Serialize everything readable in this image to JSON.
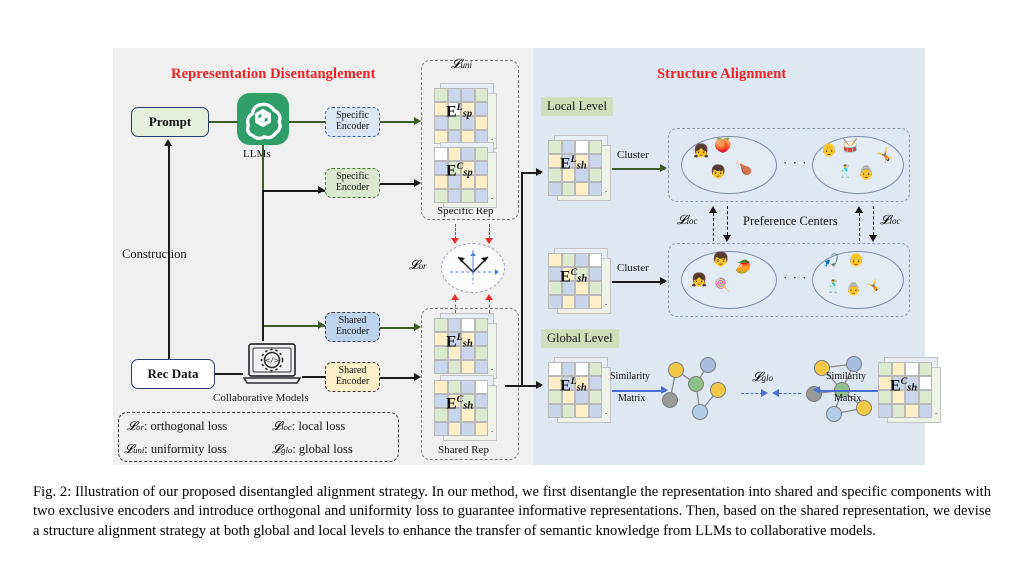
{
  "figure": {
    "panels": {
      "left": {
        "title": "Representation Disentanglement",
        "bg": "#f0f0f0"
      },
      "right": {
        "title": "Structure Alignment",
        "bg": "#dde8f3"
      }
    },
    "title_color": "#ee2020",
    "left_flow": {
      "prompt_label": "Prompt",
      "rec_data_label": "Rec Data",
      "construction_label": "Construction",
      "llms_label": "LLMs",
      "collaborative_models_label": "Collaborative Models",
      "encoders": [
        {
          "id": "specific-l",
          "line1": "Specific",
          "line2": "Encoder",
          "fill": "#dce7f5",
          "border": "#3b62a8"
        },
        {
          "id": "specific-c",
          "line1": "Specific",
          "line2": "Encoder",
          "fill": "#d9e8cf",
          "border": "#4d7a36"
        },
        {
          "id": "shared-l",
          "line1": "Shared",
          "line2": "Encoder",
          "fill": "#bdd3ee",
          "border": "#3a3a3a"
        },
        {
          "id": "shared-c",
          "line1": "Shared",
          "line2": "Encoder",
          "fill": "#fdf0c9",
          "border": "#3a3a3a"
        }
      ],
      "specific_rep_label": "Specific Rep",
      "shared_rep_label": "Shared Rep",
      "uniformity_loss": "𝓛",
      "uniformity_loss_sub": "uni",
      "orthogonal_loss": "𝓛",
      "orthogonal_loss_sub": "or"
    },
    "matrices": {
      "sp_l": {
        "base": "E",
        "sup": "L",
        "sub": "sp"
      },
      "sp_c": {
        "base": "E",
        "sup": "C",
        "sub": "sp"
      },
      "sh_l_left": {
        "base": "E",
        "sup": "L",
        "sub": "sh"
      },
      "sh_c_left": {
        "base": "E",
        "sup": "C",
        "sub": "sh"
      },
      "sh_l_local": {
        "base": "E",
        "sup": "L",
        "sub": "sh"
      },
      "sh_c_local": {
        "base": "E",
        "sup": "C",
        "sub": "sh"
      },
      "sh_l_global": {
        "base": "E",
        "sup": "L",
        "sub": "sh"
      },
      "sh_c_global": {
        "base": "E",
        "sup": "C",
        "sub": "sh"
      },
      "cell_palette": [
        "#fdf0c9",
        "#c9d6ec",
        "#dcead0",
        "#ffffff"
      ]
    },
    "right_flow": {
      "local_level_label": "Local Level",
      "global_level_label": "Global Level",
      "cluster_label_top": "Cluster",
      "cluster_label_bottom": "Cluster",
      "preference_centers_label": "Preference Centers",
      "local_loss_left": "𝓛",
      "local_loss_left_sub": "loc",
      "local_loss_right": "𝓛",
      "local_loss_right_sub": "loc",
      "global_loss": "𝓛",
      "global_loss_sub": "glo",
      "similarity_matrix_left_l1": "Similarity",
      "similarity_matrix_left_l2": "Matrix",
      "similarity_matrix_right_l1": "Similarity",
      "similarity_matrix_right_l2": "Matrix",
      "ellipsis": "· · ·",
      "clusters": {
        "top_left": [
          "👧",
          "🍑",
          "👦",
          "🍗"
        ],
        "top_right": [
          "👴",
          "🥁",
          "🕺",
          "👵",
          "🤸"
        ],
        "bottom_left": [
          "👦",
          "🥭",
          "👧",
          "🍭"
        ],
        "bottom_right": [
          "🎣",
          "👴",
          "🕺",
          "👵",
          "🤸"
        ]
      },
      "graph_node_colors": [
        "#f2c846",
        "#a8bde0",
        "#8fc08a",
        "#9a9a9a",
        "#b3cde8"
      ]
    },
    "legend": {
      "rows": [
        {
          "sym": "𝓛",
          "sub": "or",
          "text": ": orthogonal loss"
        },
        {
          "sym": "𝓛",
          "sub": "loc",
          "text": ": local loss"
        },
        {
          "sym": "𝓛",
          "sub": "uni",
          "text": ": uniformity loss"
        },
        {
          "sym": "𝓛",
          "sub": "glo",
          "text": ": global loss"
        }
      ]
    },
    "caption": "Fig. 2: Illustration of our proposed disentangled alignment strategy. In our method, we first disentangle the representation into shared and specific components with two exclusive encoders and introduce orthogonal and uniformity loss to guarantee informative representations. Then, based on the shared representation, we devise a structure alignment strategy at both global and local levels to enhance the transfer of semantic knowledge from LLMs to collaborative models."
  }
}
